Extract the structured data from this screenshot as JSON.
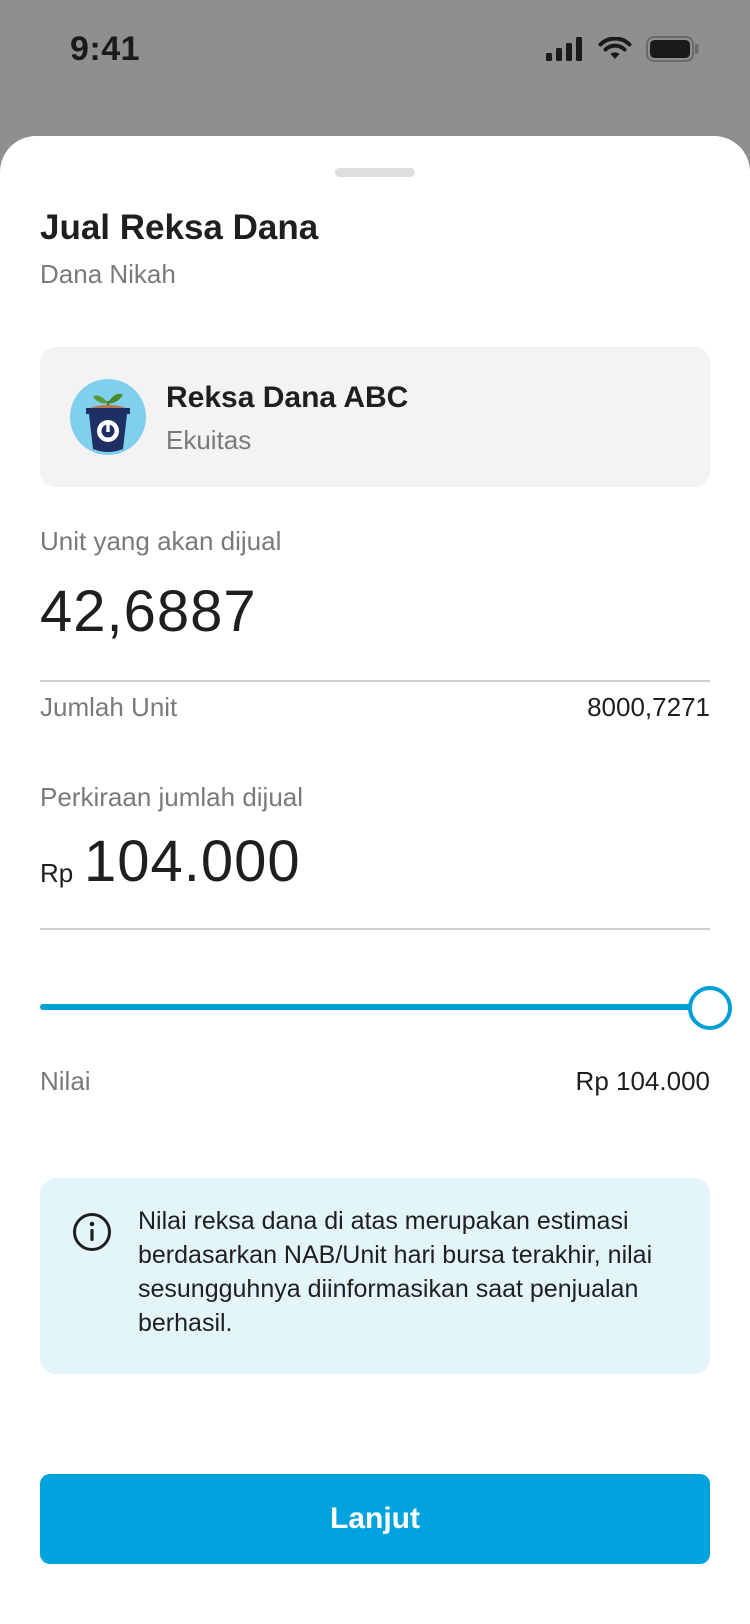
{
  "status_bar": {
    "time": "9:41",
    "icons": [
      "signal-icon",
      "wifi-icon",
      "battery-icon"
    ]
  },
  "sheet": {
    "title": "Jual Reksa Dana",
    "subtitle": "Dana Nikah"
  },
  "fund": {
    "name": "Reksa Dana ABC",
    "type": "Ekuitas",
    "logo_icon": "plant-pot-icon"
  },
  "units": {
    "label": "Unit yang akan dijual",
    "value": "42,6887",
    "total_label": "Jumlah Unit",
    "total_value": "8000,7271"
  },
  "estimate": {
    "label": "Perkiraan jumlah dijual",
    "currency": "Rp",
    "value": "104.000"
  },
  "slider": {
    "level_fraction": 1.0,
    "label": "Nilai",
    "value": "Rp 104.000"
  },
  "info": {
    "icon": "info-icon",
    "text": "Nilai reksa dana di atas merupakan estimasi berdasarkan NAB/Unit hari bursa terakhir, nilai sesungguhnya diinformasikan saat penjualan berhasil."
  },
  "cta": {
    "label": "Lanjut"
  },
  "colors": {
    "accent": "#00a3dd",
    "info_background": "#e3f4fb",
    "overlay": "#8f8f8f"
  }
}
